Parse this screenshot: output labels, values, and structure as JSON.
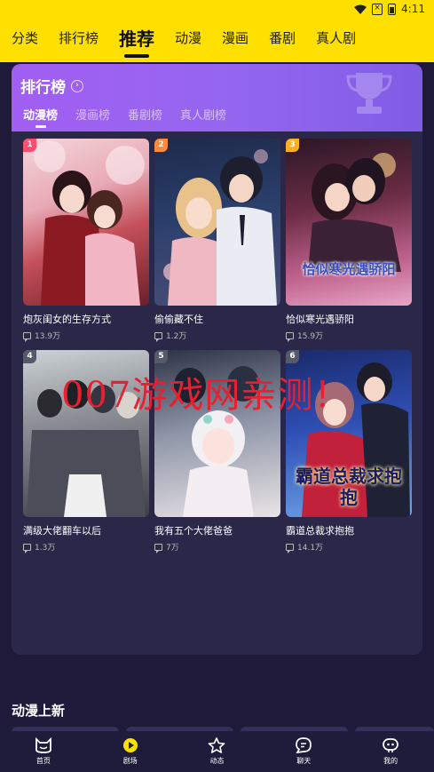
{
  "status_bar": {
    "time": "4:11"
  },
  "top_nav": {
    "tabs": [
      {
        "label": "分类",
        "active": false
      },
      {
        "label": "排行榜",
        "active": false
      },
      {
        "label": "推荐",
        "active": true
      },
      {
        "label": "动漫",
        "active": false
      },
      {
        "label": "漫画",
        "active": false
      },
      {
        "label": "番剧",
        "active": false
      },
      {
        "label": "真人剧",
        "active": false
      }
    ]
  },
  "ranking": {
    "title": "排行榜",
    "tabs": [
      "动漫榜",
      "漫画榜",
      "番剧榜",
      "真人剧榜"
    ],
    "active_tab": "动漫榜",
    "items": [
      {
        "rank": "1",
        "title": "炮灰闺女的生存方式",
        "count": "13.9万",
        "rank_color": "#ff4d6d"
      },
      {
        "rank": "2",
        "title": "偷偷藏不住",
        "count": "1.2万",
        "rank_color": "#ff8a3d"
      },
      {
        "rank": "3",
        "title": "恰似寒光遇骄阳",
        "count": "15.9万",
        "rank_color": "#ffb020"
      },
      {
        "rank": "4",
        "title": "满级大佬翻车以后",
        "count": "1.3万",
        "rank_color": "#555a6a"
      },
      {
        "rank": "5",
        "title": "我有五个大佬爸爸",
        "count": "7万",
        "rank_color": "#555a6a"
      },
      {
        "rank": "6",
        "title": "霸道总裁求抱抱",
        "count": "14.1万",
        "rank_color": "#555a6a"
      }
    ],
    "cover_text": {
      "cover3": "恰似寒光遇骄阳",
      "cover6": "霸道总裁求抱抱"
    }
  },
  "watermark": "007游戏网亲测！",
  "section": {
    "title": "动漫上新"
  },
  "bottom_nav": [
    {
      "label": "首页",
      "icon": "cat-face-icon"
    },
    {
      "label": "剧场",
      "icon": "play-icon"
    },
    {
      "label": "动态",
      "icon": "star-icon"
    },
    {
      "label": "聊天",
      "icon": "chat-icon"
    },
    {
      "label": "我的",
      "icon": "profile-face-icon"
    }
  ],
  "colors": {
    "header": "#ffe000",
    "panel_gradient": "#a15ef2",
    "accent_play": "#ffe000"
  }
}
